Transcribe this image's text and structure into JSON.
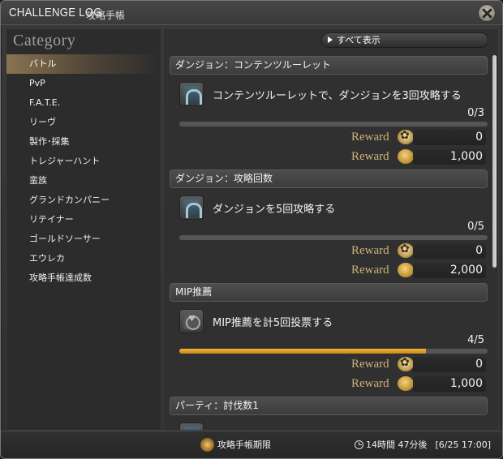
{
  "window": {
    "title_en": "CHALLENGE LOG",
    "title_ja": "攻略手帳"
  },
  "sidebar": {
    "heading": "Category",
    "items": [
      {
        "label": "バトル",
        "selected": true
      },
      {
        "label": "PvP"
      },
      {
        "label": "F.A.T.E."
      },
      {
        "label": "リーヴ"
      },
      {
        "label": "製作･採集"
      },
      {
        "label": "トレジャーハント"
      },
      {
        "label": "蛮族"
      },
      {
        "label": "グランドカンパニー"
      },
      {
        "label": "リテイナー"
      },
      {
        "label": "ゴールドソーサー"
      },
      {
        "label": "エウレカ"
      },
      {
        "label": "攻略手帳達成数"
      }
    ]
  },
  "main": {
    "show_all_label": "すべて表示",
    "sections": [
      {
        "header": "ダンジョン：コンテンツルーレット",
        "icon": "dungeon-icon",
        "task": "コンテンツルーレットで、ダンジョンを3回攻略する",
        "progress_text": "0/3",
        "progress": 0.0,
        "rewards": [
          {
            "label": "Reward",
            "icon": "mgp-icon",
            "value": "0"
          },
          {
            "label": "Reward",
            "icon": "gil-icon",
            "value": "1,000"
          }
        ]
      },
      {
        "header": "ダンジョン：攻略回数",
        "icon": "dungeon-icon",
        "task": "ダンジョンを5回攻略する",
        "progress_text": "0/5",
        "progress": 0.0,
        "rewards": [
          {
            "label": "Reward",
            "icon": "mgp-icon",
            "value": "0"
          },
          {
            "label": "Reward",
            "icon": "gil-icon",
            "value": "2,000"
          }
        ]
      },
      {
        "header": "MIP推薦",
        "icon": "heart-icon",
        "task": "MIP推薦を計5回投票する",
        "progress_text": "4/5",
        "progress": 0.8,
        "rewards": [
          {
            "label": "Reward",
            "icon": "mgp-icon",
            "value": "0"
          },
          {
            "label": "Reward",
            "icon": "gil-icon",
            "value": "1,000"
          }
        ]
      },
      {
        "header": "パーティ：討伐数1"
      }
    ]
  },
  "footer": {
    "deadline_label": "攻略手帳期限",
    "remaining": "14時間 47分後",
    "reset_time": "[6/25 17:00]"
  },
  "colors": {
    "reward_label": "#cfb37a",
    "progress_fill": "#e6a92c",
    "selected_category": "#8a7350"
  }
}
